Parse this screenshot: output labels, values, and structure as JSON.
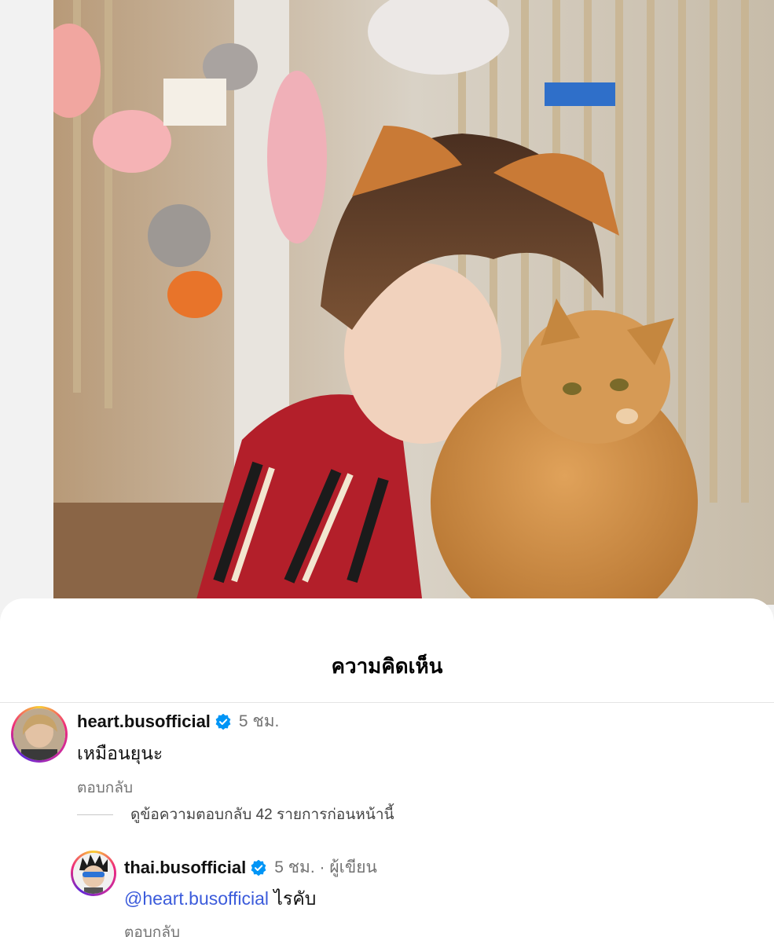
{
  "sheet": {
    "title": "ความคิดเห็น"
  },
  "comments": [
    {
      "username": "heart.busofficial",
      "time": "5 ชม.",
      "text": "เหมือนยุนะ",
      "reply_label": "ตอบกลับ",
      "view_replies": "ดูข้อความตอบกลับ 42 รายการก่อนหน้านี้"
    }
  ],
  "reply": {
    "username": "thai.busofficial",
    "meta": "5 ชม. · ผู้เขียน",
    "mention": "@heart.busofficial",
    "text": " ไรคับ",
    "reply_label": "ตอบกลับ"
  },
  "colors": {
    "verified": "#0095f6",
    "mention": "#3b5bdb",
    "meta": "#737373"
  }
}
